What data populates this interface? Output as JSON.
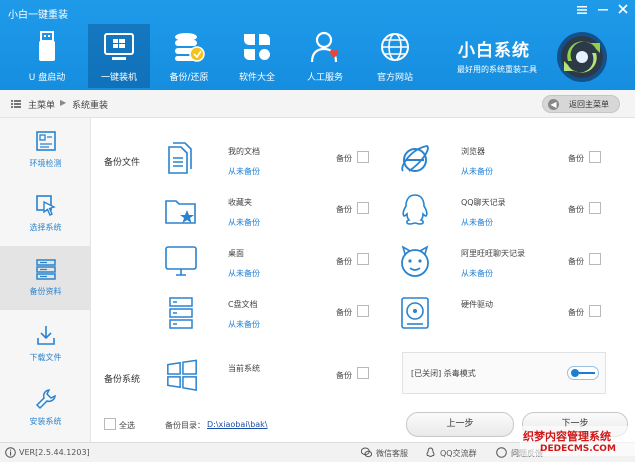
{
  "window": {
    "title": "小白一键重装"
  },
  "nav": {
    "items": [
      {
        "label": "U 盘启动",
        "icon": "usb-drive-icon"
      },
      {
        "label": "一键装机",
        "icon": "windows-icon",
        "active": true
      },
      {
        "label": "备份/还原",
        "icon": "database-icon"
      },
      {
        "label": "软件大全",
        "icon": "apps-grid-icon"
      },
      {
        "label": "人工服务",
        "icon": "support-person-icon"
      },
      {
        "label": "官方网站",
        "icon": "globe-icon"
      }
    ]
  },
  "brand": {
    "name": "小白系统",
    "tagline": "最好用的系统重装工具"
  },
  "breadcrumb": {
    "home": "主菜单",
    "separator": "▶",
    "current": "系统重装",
    "back_label": "返回主菜单"
  },
  "sidebar": {
    "items": [
      {
        "label": "环境检测",
        "icon": "checklist-icon"
      },
      {
        "label": "选择系统",
        "icon": "cursor-select-icon"
      },
      {
        "label": "备份资料",
        "icon": "server-backup-icon",
        "active": true
      },
      {
        "label": "下载文件",
        "icon": "download-icon"
      },
      {
        "label": "安装系统",
        "icon": "wrench-icon"
      }
    ]
  },
  "content": {
    "backup_files_label": "备份文件",
    "backup_system_label": "备份系统",
    "checkbox_label": "备份",
    "left_items": [
      {
        "name": "我的文档",
        "status": "从未备份"
      },
      {
        "name": "收藏夹",
        "status": "从未备份"
      },
      {
        "name": "桌面",
        "status": "从未备份"
      },
      {
        "name": "C盘文档",
        "status": "从未备份"
      }
    ],
    "right_items": [
      {
        "name": "浏览器",
        "status": "从未备份"
      },
      {
        "name": "QQ聊天记录",
        "status": "从未备份"
      },
      {
        "name": "阿里旺旺聊天记录",
        "status": "从未备份"
      },
      {
        "name": "硬件驱动",
        "status": ""
      }
    ],
    "system_item": {
      "name": "当前系统"
    },
    "antivirus": {
      "label": "[已关闭] 杀毒模式",
      "enabled": false
    }
  },
  "footer": {
    "select_all": "全选",
    "dir_label": "备份目录：",
    "dir_path": "D:\\xiaobai\\bak\\",
    "prev_button": "上一步",
    "next_button": "下一步"
  },
  "status": {
    "version": "VER[2.5.44.1203]",
    "wechat": "微信客服",
    "qq": "QQ交流群",
    "question": "问题反馈"
  },
  "watermark": {
    "line1": "织梦内容管理系统",
    "line2": "DEDECMS.COM"
  },
  "colors": {
    "header": "#1b96e6",
    "accent": "#1a7ed7",
    "watermark": "#d01818"
  }
}
